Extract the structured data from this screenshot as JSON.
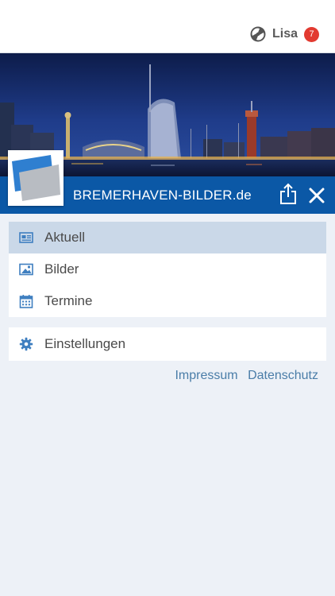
{
  "header": {
    "user_name": "Lisa",
    "notification_count": "7"
  },
  "site": {
    "title": "BREMERHAVEN-BILDER.de"
  },
  "icons": {
    "user": "user-ring-icon",
    "share": "share-icon",
    "close": "close-icon",
    "news": "newspaper-icon",
    "images": "image-icon",
    "calendar": "calendar-icon",
    "settings": "gear-icon"
  },
  "menu": {
    "items": [
      {
        "label": "Aktuell",
        "icon": "newspaper-icon",
        "active": true
      },
      {
        "label": "Bilder",
        "icon": "image-icon",
        "active": false
      },
      {
        "label": "Termine",
        "icon": "calendar-icon",
        "active": false
      }
    ],
    "settings_label": "Einstellungen"
  },
  "footer": {
    "impressum": "Impressum",
    "datenschutz": "Datenschutz"
  },
  "colors": {
    "brand_blue": "#0b58a6",
    "active_row": "#cad8e8",
    "icon_blue": "#3f7fc0",
    "badge_red": "#e23a30",
    "link_blue": "#4a7da8",
    "page_bg": "#edf1f7"
  }
}
